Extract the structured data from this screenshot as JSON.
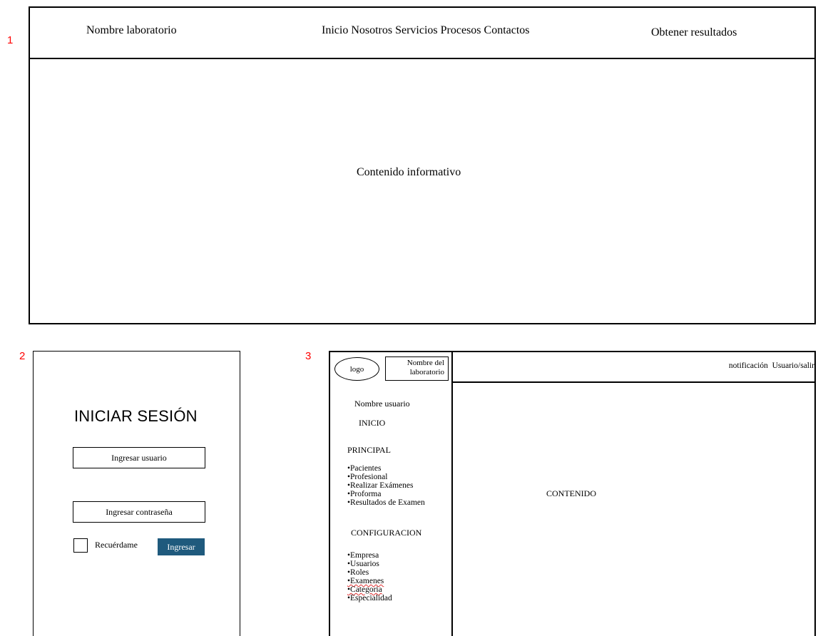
{
  "labels": {
    "one": "1",
    "two": "2",
    "three": "3"
  },
  "mockup1": {
    "brand": "Nombre laboratorio",
    "nav": "Inicio Nosotros Servicios Procesos Contactos",
    "results_button": "Obtener resultados",
    "content": "Contenido informativo"
  },
  "mockup2": {
    "title": "INICIAR SESIÓN",
    "username_placeholder": "Ingresar usuario",
    "password_placeholder": "Ingresar contraseña",
    "remember_label": "Recuérdame",
    "submit_label": "Ingresar",
    "submit_color": "#1f5a7d"
  },
  "mockup3": {
    "logo": "logo",
    "lab_name": "Nombre del laboratorio",
    "user_name": "Nombre usuario",
    "home": "INICIO",
    "main_section": "PRINCIPAL",
    "main_items": [
      "•Pacientes",
      "•Profesional",
      "•Realizar Exámenes",
      "•Proforma",
      "•Resultados de Examen"
    ],
    "config_section": "CONFIGURACION",
    "config_items": [
      "•Empresa",
      "•Usuarios",
      "•Roles",
      "•Examenes",
      "•Categoria",
      "•Especialidad"
    ],
    "notification": "notificación",
    "user_exit": "Usuario/salir",
    "content": "CONTENIDO"
  }
}
